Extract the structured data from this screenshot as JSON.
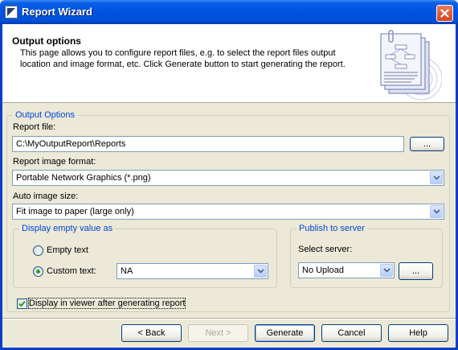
{
  "window": {
    "title": "Report Wizard",
    "close_label": "close"
  },
  "header": {
    "title": "Output options",
    "description": "This page allows you to configure report files, e.g. to select the report files output location and image format, etc. Click Generate button to start generating the report."
  },
  "output_options": {
    "group_label": "Output Options",
    "report_file_label": "Report file:",
    "report_file_value": "C:\\MyOutputReport\\Reports",
    "browse_label": "...",
    "image_format_label": "Report image format:",
    "image_format_value": "Portable Network Graphics (*.png)",
    "auto_size_label": "Auto image size:",
    "auto_size_value": "Fit image to paper (large only)"
  },
  "empty_value": {
    "group_label": "Display empty value as",
    "option_empty": "Empty text",
    "option_custom": "Custom text:",
    "selected": "custom",
    "custom_value": "NA"
  },
  "publish": {
    "group_label": "Publish to server",
    "select_label": "Select server:",
    "server_value": "No Upload",
    "browse_label": "..."
  },
  "viewer_checkbox": {
    "label": "Display in viewer after generating report",
    "checked": true
  },
  "footer": {
    "back_label": "< Back",
    "next_label": "Next >",
    "generate_label": "Generate",
    "cancel_label": "Cancel",
    "help_label": "Help"
  },
  "colors": {
    "titlebar": "#0053e1",
    "group_label": "#0046d5",
    "dialog_bg": "#ece9d8"
  }
}
